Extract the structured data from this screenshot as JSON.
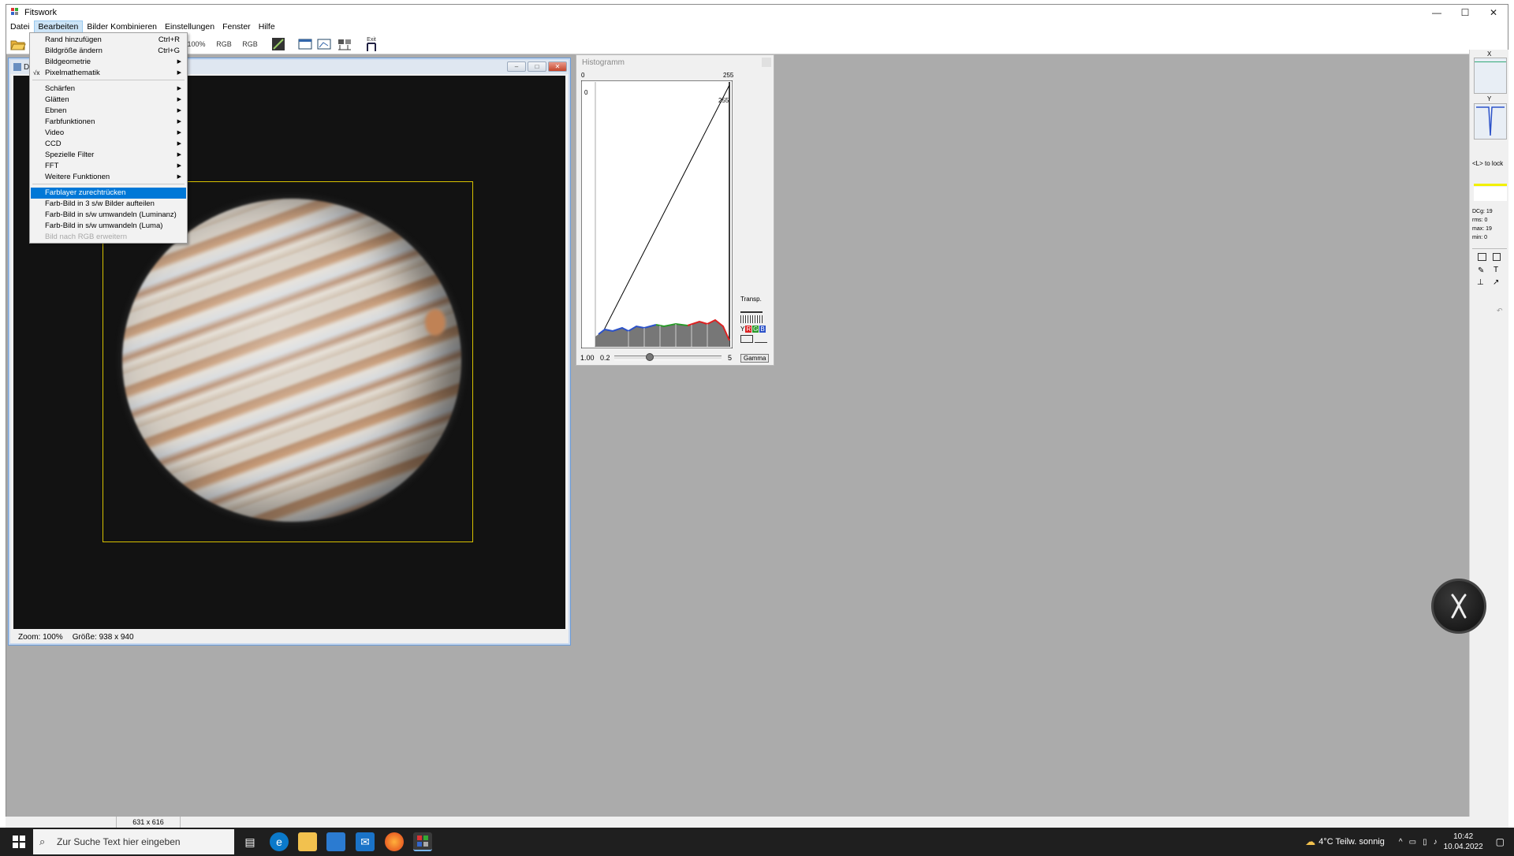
{
  "window": {
    "title": "Fitswork",
    "controls": [
      "—",
      "☐",
      "✕"
    ]
  },
  "menubar": [
    "Datei",
    "Bearbeiten",
    "Bilder Kombinieren",
    "Einstellungen",
    "Fenster",
    "Hilfe"
  ],
  "toolbar": {
    "zoom_label": "100%",
    "rgb1": "RGB",
    "rgb2": "RGB",
    "exit_label": "Exit"
  },
  "image_window": {
    "title": "D",
    "zoom": "Zoom: 100%",
    "size": "Größe: 938 x 940"
  },
  "histogram": {
    "title": "Histogramm",
    "axis_left": "0",
    "axis_right": "255",
    "y_low": "0",
    "y_high": "255",
    "transp_label": "Transp.",
    "channel_y": "Y",
    "channel_r": "R",
    "channel_g": "G",
    "channel_b": "B",
    "gamma_value": "1.00",
    "slider_min": "0.2",
    "slider_max": "5",
    "gamma_button": "Gamma",
    "gamma_slider_position": 0.33
  },
  "right_panel": {
    "x_label": "X",
    "y_label": "Y",
    "lock_hint": "<L> to lock",
    "stats": [
      "DCg: 19",
      "rms: 0",
      "max: 19",
      "min: 0"
    ]
  },
  "statusbar": {
    "dimensions": "631 x 616"
  },
  "menu": {
    "items": [
      {
        "label": "Rand hinzufügen",
        "shortcut": "Ctrl+R",
        "submenu": false
      },
      {
        "label": "Bildgröße ändern",
        "shortcut": "Ctrl+G",
        "submenu": false
      },
      {
        "label": "Bildgeometrie",
        "shortcut": "",
        "submenu": true
      },
      {
        "label": "Pixelmathematik",
        "shortcut": "",
        "submenu": true,
        "icon": "√x"
      },
      {
        "label": "Schärfen",
        "shortcut": "",
        "submenu": true
      },
      {
        "label": "Glätten",
        "shortcut": "",
        "submenu": true
      },
      {
        "label": "Ebnen",
        "shortcut": "",
        "submenu": true
      },
      {
        "label": "Farbfunktionen",
        "shortcut": "",
        "submenu": true
      },
      {
        "label": "Video",
        "shortcut": "",
        "submenu": true
      },
      {
        "label": "CCD",
        "shortcut": "",
        "submenu": true
      },
      {
        "label": "Spezielle Filter",
        "shortcut": "",
        "submenu": true
      },
      {
        "label": "FFT",
        "shortcut": "",
        "submenu": true
      },
      {
        "label": "Weitere Funktionen",
        "shortcut": "",
        "submenu": true
      },
      {
        "label": "Farblayer zurechtrücken",
        "shortcut": "",
        "submenu": false,
        "highlighted": true
      },
      {
        "label": "Farb-Bild in 3 s/w Bilder aufteilen",
        "shortcut": "",
        "submenu": false
      },
      {
        "label": "Farb-Bild in s/w umwandeln (Luminanz)",
        "shortcut": "",
        "submenu": false
      },
      {
        "label": "Farb-Bild in s/w umwandeln (Luma)",
        "shortcut": "",
        "submenu": false
      },
      {
        "label": "Bild nach RGB erweitern",
        "shortcut": "",
        "submenu": false,
        "disabled": true
      }
    ]
  },
  "taskbar": {
    "search_placeholder": "Zur Suche Text hier eingeben",
    "weather": "4°C  Teilw. sonnig",
    "time": "10:42",
    "date": "10.04.2022"
  },
  "colors": {
    "highlight": "#0078d7",
    "workspace": "#ababab",
    "selection_rect": "#d8c200"
  }
}
